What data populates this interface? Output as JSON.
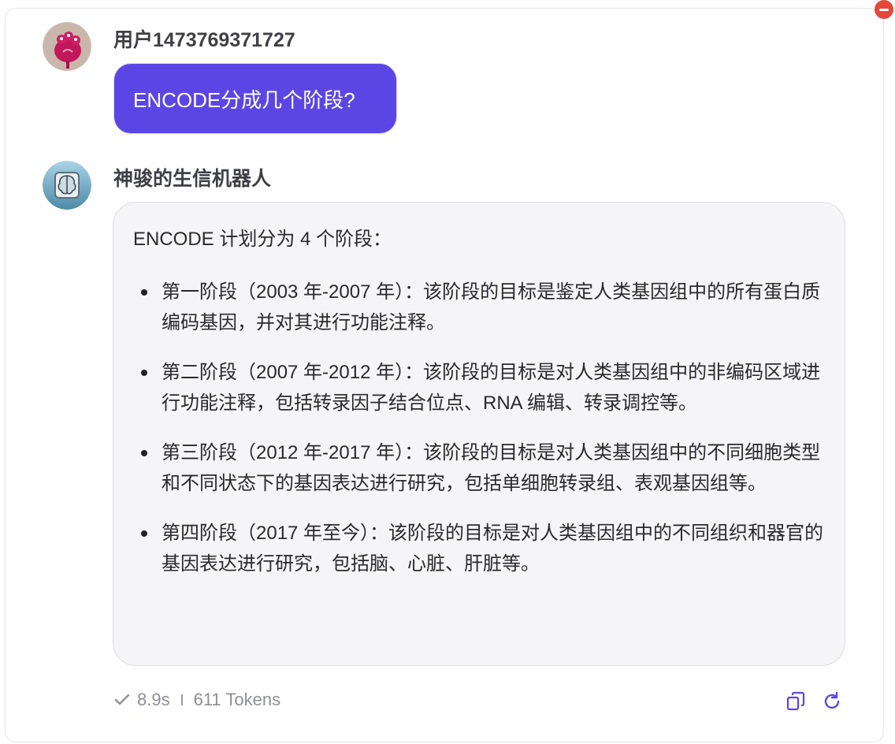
{
  "user": {
    "name": "用户1473769371727",
    "message": "ENCODE分成几个阶段?"
  },
  "bot": {
    "name": "神骏的生信机器人",
    "intro": "ENCODE 计划分为 4 个阶段：",
    "items": [
      {
        "text": "第一阶段（2003 年-2007 年）：该阶段的目标是鉴定人类基因组中的所有蛋白质编码基因，并对其进行功能注释。"
      },
      {
        "text": "第二阶段（2007 年-2012 年）：该阶段的目标是对人类基因组中的非编码区域进行功能注释，包括转录因子结合位点、RNA 编辑、转录调控等。"
      },
      {
        "text": "第三阶段（2012 年-2017 年）：该阶段的目标是对人类基因组中的不同细胞类型和不同状态下的基因表达进行研究，包括单细胞转录组、表观基因组等。"
      },
      {
        "text": "第四阶段（2017 年至今）：该阶段的目标是对人类基因组中的不同组织和器官的基因表达进行研究，包括脑、心脏、肝脏等。"
      }
    ]
  },
  "footer": {
    "duration": "8.9s",
    "tokens": "611 Tokens"
  },
  "icons": {
    "check": "check-icon",
    "copy": "copy-icon",
    "refresh": "refresh-icon",
    "remove": "remove-icon"
  },
  "colors": {
    "accent": "#5b46e5",
    "remove": "#e5483b",
    "muted": "#8e8e96"
  }
}
